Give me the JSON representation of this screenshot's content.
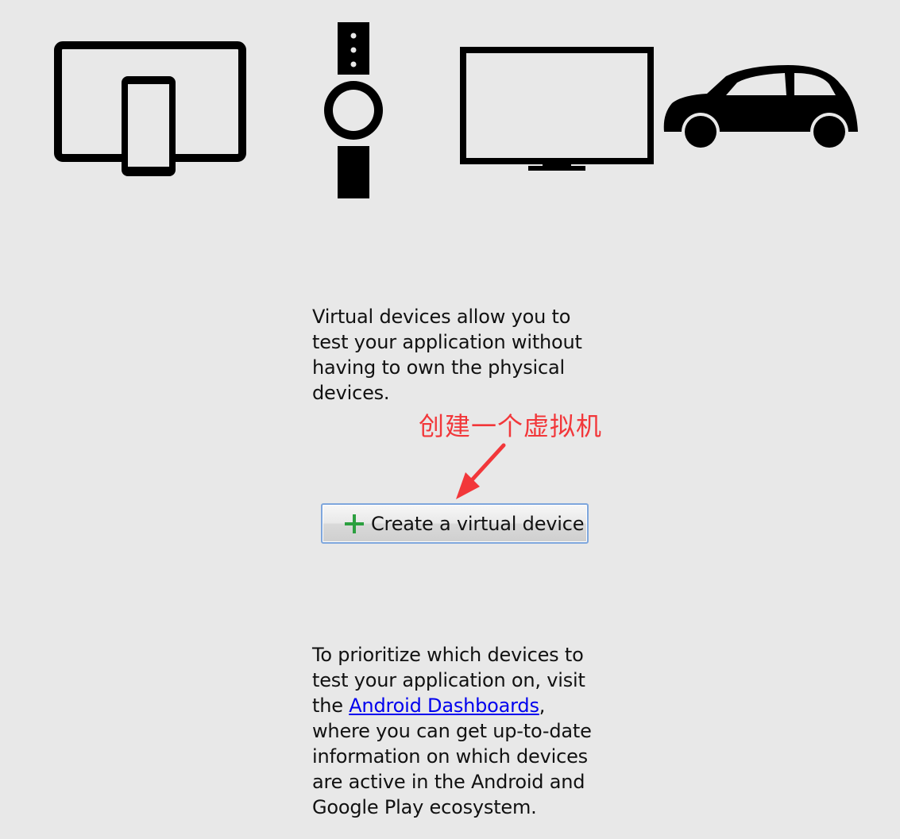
{
  "icons": {
    "tablet_phone": "tablet-phone-icon",
    "watch": "smartwatch-icon",
    "tv": "television-icon",
    "car": "car-icon"
  },
  "intro_text": "Virtual devices allow you to test your application without having to own the physical devices.",
  "annotation": {
    "text": "创建一个虚拟机",
    "color": "#f2373a"
  },
  "create_button": {
    "icon": "plus-icon",
    "icon_color": "#2ca040",
    "label": "Create a virtual device"
  },
  "info": {
    "before_link": "To prioritize which devices to test your application on, visit the ",
    "link_text": "Android Dashboards",
    "after_link": ", where you can get up-to-date information on which devices are active in the Android and Google Play ecosystem."
  },
  "colors": {
    "background": "#e8e8e8",
    "link": "#0000ee",
    "button_border": "#7ea6dc"
  }
}
